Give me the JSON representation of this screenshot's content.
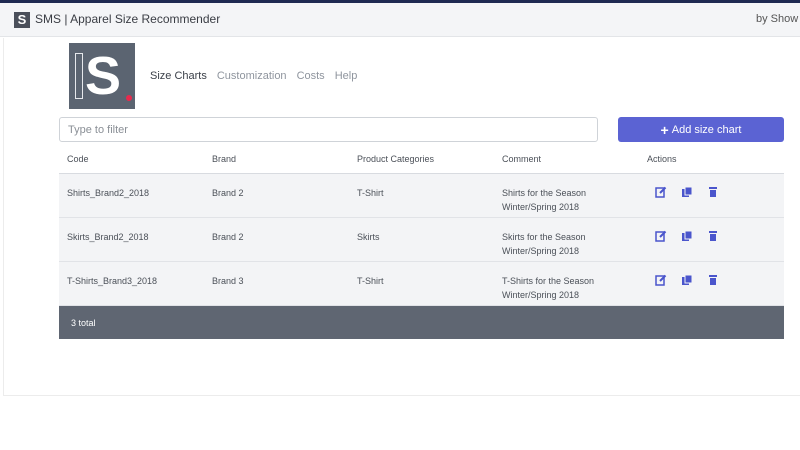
{
  "app": {
    "logo_letter": "S",
    "title": "SMS | Apparel Size Recommender",
    "by_text": "by Show r"
  },
  "brand": {
    "logo_letter": "S",
    "accent_color": "#e8294d"
  },
  "nav": {
    "items": [
      {
        "label": "Size Charts",
        "active": true
      },
      {
        "label": "Customization",
        "active": false
      },
      {
        "label": "Costs",
        "active": false
      },
      {
        "label": "Help",
        "active": false
      }
    ]
  },
  "filter": {
    "placeholder": "Type to filter",
    "value": ""
  },
  "add_button": {
    "icon": "plus-icon",
    "label": "Add size chart",
    "color": "#5b63d3"
  },
  "table": {
    "columns": [
      "Code",
      "Brand",
      "Product Categories",
      "Comment",
      "Actions"
    ],
    "rows": [
      {
        "code": "Shirts_Brand2_2018",
        "brand": "Brand 2",
        "category": "T-Shirt",
        "comment_1": "Shirts for the Season",
        "comment_2": "Winter/Spring 2018"
      },
      {
        "code": "Skirts_Brand2_2018",
        "brand": "Brand 2",
        "category": "Skirts",
        "comment_1": "Skirts for the Season",
        "comment_2": "Winter/Spring 2018"
      },
      {
        "code": "T-Shirts_Brand3_2018",
        "brand": "Brand 3",
        "category": "T-Shirt",
        "comment_1": "T-Shirts for the Season",
        "comment_2": "Winter/Spring 2018"
      }
    ],
    "action_icons": [
      "edit-icon",
      "copy-icon",
      "trash-icon"
    ],
    "action_color": "#4a55cc",
    "footer_total": "3 total"
  }
}
